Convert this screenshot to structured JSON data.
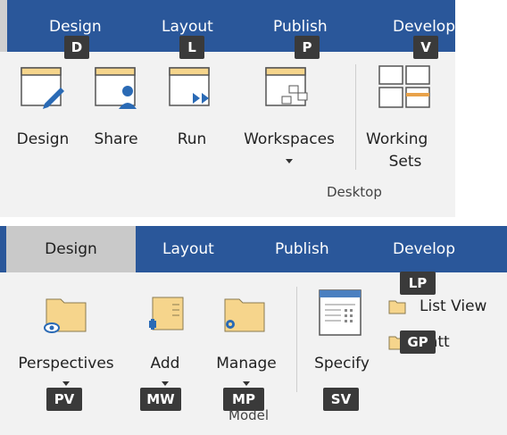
{
  "top": {
    "tabs": [
      {
        "label": "Design",
        "key": "D"
      },
      {
        "label": "Layout",
        "key": "L"
      },
      {
        "label": "Publish",
        "key": "P"
      },
      {
        "label": "Develop",
        "key": "V"
      }
    ],
    "buttons": [
      {
        "label": "Design"
      },
      {
        "label": "Share"
      },
      {
        "label": "Run"
      },
      {
        "label": "Workspaces"
      },
      {
        "label": "Working",
        "label2": "Sets"
      }
    ],
    "group_label": "Desktop"
  },
  "bottom": {
    "tabs": [
      {
        "label": "Design"
      },
      {
        "label": "Layout"
      },
      {
        "label": "Publish"
      },
      {
        "label": "Develop"
      }
    ],
    "buttons": [
      {
        "label": "Perspectives",
        "key": "PV"
      },
      {
        "label": "Add",
        "key": "MW"
      },
      {
        "label": "Manage",
        "key": "MP"
      },
      {
        "label": "Specify",
        "key": "SV"
      }
    ],
    "small_buttons": [
      {
        "label": "List View",
        "key": "LP"
      },
      {
        "label": "Gantt",
        "key": "GP"
      }
    ],
    "group_label": "Model"
  },
  "colors": {
    "tabbar": "#2a579a",
    "ribbon": "#f2f2f2",
    "keytip": "#3a3a3a",
    "folder": "#f6d58c"
  }
}
